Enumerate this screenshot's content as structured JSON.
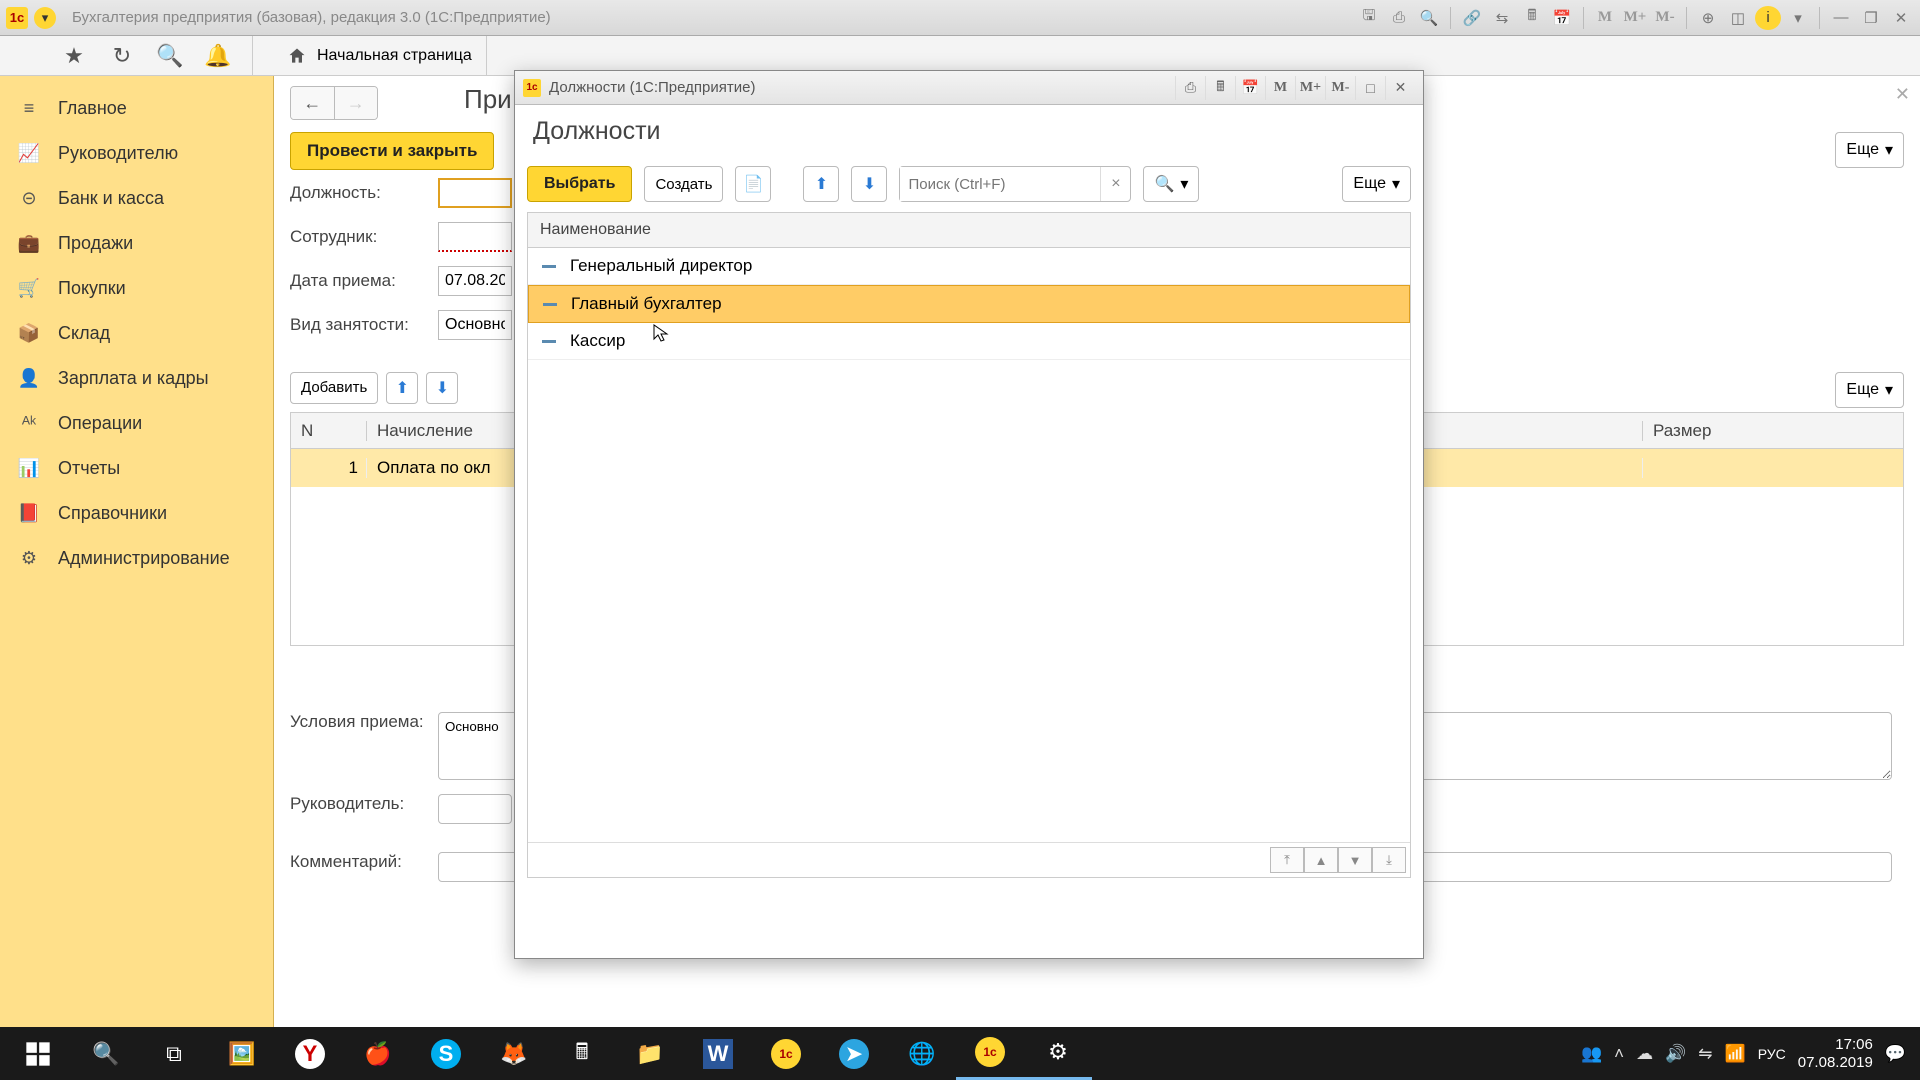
{
  "titlebar": {
    "title": "Бухгалтерия предприятия (базовая), редакция 3.0  (1С:Предприятие)",
    "m": "M",
    "m_plus": "M+",
    "m_minus": "M-"
  },
  "home_tab": "Начальная страница",
  "sidebar": {
    "items": [
      {
        "label": "Главное"
      },
      {
        "label": "Руководителю"
      },
      {
        "label": "Банк и касса"
      },
      {
        "label": "Продажи"
      },
      {
        "label": "Покупки"
      },
      {
        "label": "Склад"
      },
      {
        "label": "Зарплата и кадры"
      },
      {
        "label": "Операции"
      },
      {
        "label": "Отчеты"
      },
      {
        "label": "Справочники"
      },
      {
        "label": "Администрирование"
      }
    ]
  },
  "form": {
    "page_title_partial": "При",
    "submit": "Провести и закрыть",
    "more": "Еще",
    "labels": {
      "position": "Должность:",
      "employee": "Сотрудник:",
      "date": "Дата приема:",
      "employment": "Вид занятости:",
      "add": "Добавить",
      "conditions": "Условия приема:",
      "manager": "Руководитель:",
      "comment": "Комментарий:"
    },
    "values": {
      "date": "07.08.20",
      "employment": "Основно",
      "conditions": "Основно"
    },
    "table": {
      "h1": "N",
      "h2": "Начисление",
      "h3": "Размер",
      "r1_n": "1",
      "r1_charge": "Оплата по окл"
    }
  },
  "modal": {
    "wintitle": "Должности  (1С:Предприятие)",
    "header": "Должности",
    "select": "Выбрать",
    "create": "Создать",
    "search_placeholder": "Поиск (Ctrl+F)",
    "more": "Еще",
    "col": "Наименование",
    "rows": [
      {
        "label": "Генеральный директор"
      },
      {
        "label": "Главный бухгалтер"
      },
      {
        "label": "Кассир"
      }
    ],
    "m": "M",
    "m_plus": "M+",
    "m_minus": "M-"
  },
  "taskbar": {
    "lang": "РУС",
    "time": "17:06",
    "date": "07.08.2019"
  }
}
